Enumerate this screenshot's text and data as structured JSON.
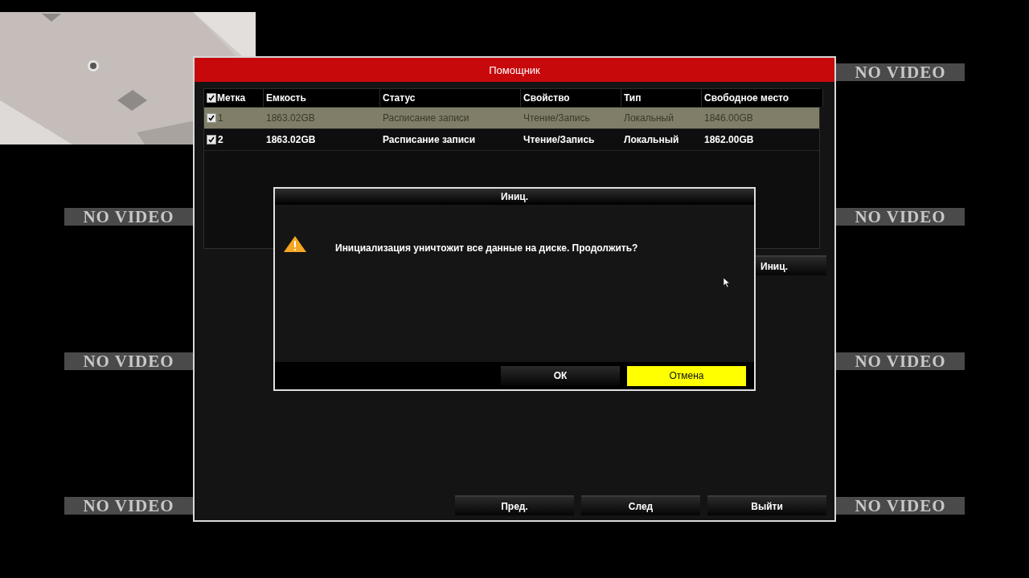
{
  "tiles": [
    {
      "kind": "picture"
    },
    {
      "kind": "empty"
    },
    {
      "kind": "empty"
    },
    {
      "kind": "no_video",
      "label": "NO VIDEO"
    },
    {
      "kind": "no_video",
      "label": "NO VIDEO"
    },
    {
      "kind": "empty"
    },
    {
      "kind": "empty"
    },
    {
      "kind": "no_video",
      "label": "NO VIDEO"
    },
    {
      "kind": "no_video",
      "label": "NO VIDEO"
    },
    {
      "kind": "empty"
    },
    {
      "kind": "empty"
    },
    {
      "kind": "no_video",
      "label": "NO VIDEO"
    },
    {
      "kind": "no_video",
      "label": "NO VIDEO"
    },
    {
      "kind": "empty"
    },
    {
      "kind": "empty"
    },
    {
      "kind": "no_video",
      "label": "NO VIDEO"
    }
  ],
  "wizard": {
    "title": "Помощник",
    "table": {
      "header_checked": true,
      "columns": [
        "Метка",
        "Емкость",
        "Статус",
        "Свойство",
        "Тип",
        "Свободное место"
      ],
      "rows": [
        {
          "checked": true,
          "selected": true,
          "cells": [
            "1",
            "1863.02GB",
            "Расписание записи",
            "Чтение/Запись",
            "Локальный",
            "1846.00GB"
          ]
        },
        {
          "checked": true,
          "selected": false,
          "cells": [
            "2",
            "1863.02GB",
            "Расписание записи",
            "Чтение/Запись",
            "Локальный",
            "1862.00GB"
          ]
        }
      ]
    },
    "init_button": "Иниц.",
    "buttons": [
      "Пред.",
      "След",
      "Выйти"
    ]
  },
  "confirm": {
    "title": "Иниц.",
    "message": "Инициализация уничтожит все данные на диске. Продолжить?",
    "buttons": [
      {
        "label": "ОК",
        "selected": false
      },
      {
        "label": "Отмена",
        "selected": true
      }
    ]
  }
}
